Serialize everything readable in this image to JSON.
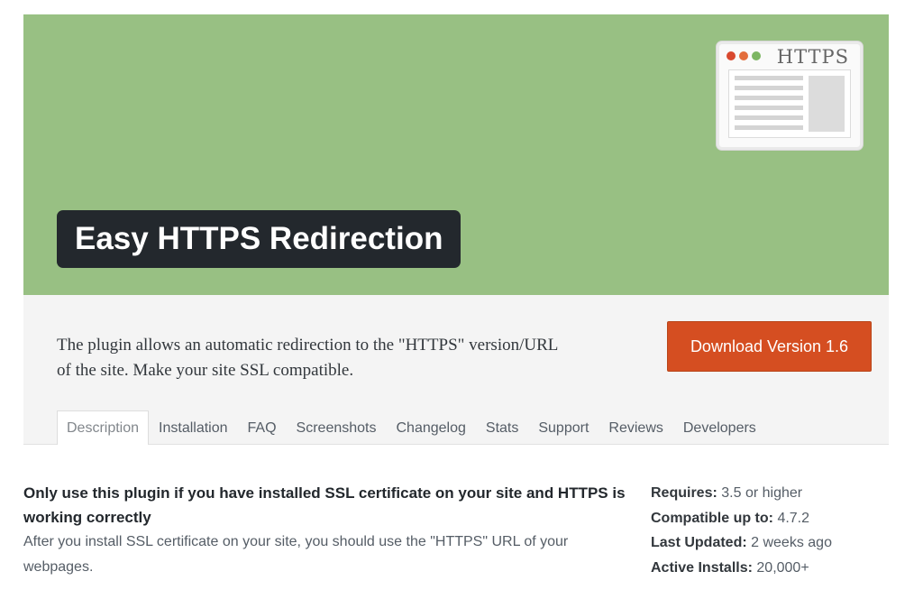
{
  "banner": {
    "title": "Easy HTTPS Redirection",
    "background_color": "#98c083",
    "browser_icon": {
      "label": "HTTPS",
      "dot_colors": [
        "#d9492f",
        "#e36d3c",
        "#7db663"
      ]
    }
  },
  "header": {
    "description": "The plugin allows an automatic redirection to the \"HTTPS\" version/URL of the site. Make your site SSL compatible.",
    "download_label": "Download Version 1.6",
    "accent_color": "#d54e21",
    "tabs": [
      {
        "label": "Description",
        "active": true
      },
      {
        "label": "Installation",
        "active": false
      },
      {
        "label": "FAQ",
        "active": false
      },
      {
        "label": "Screenshots",
        "active": false
      },
      {
        "label": "Changelog",
        "active": false
      },
      {
        "label": "Stats",
        "active": false
      },
      {
        "label": "Support",
        "active": false
      },
      {
        "label": "Reviews",
        "active": false
      },
      {
        "label": "Developers",
        "active": false
      }
    ]
  },
  "main": {
    "heading": "Only use this plugin if you have installed SSL certificate on your site and HTTPS is working correctly",
    "text": "After you install SSL certificate on your site, you should use the \"HTTPS\" URL of your webpages."
  },
  "meta": [
    {
      "label": "Requires:",
      "value": "3.5 or higher"
    },
    {
      "label": "Compatible up to:",
      "value": "4.7.2"
    },
    {
      "label": "Last Updated:",
      "value": "2 weeks ago"
    },
    {
      "label": "Active Installs:",
      "value": "20,000+"
    }
  ]
}
